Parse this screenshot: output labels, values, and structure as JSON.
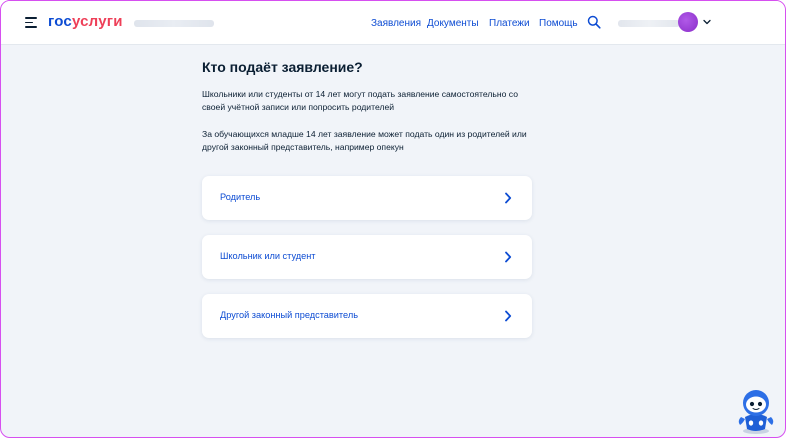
{
  "header": {
    "logo": {
      "part1": "гос",
      "part2": "услуги"
    },
    "nav": [
      "Заявления",
      "Документы",
      "Платежи",
      "Помощь"
    ],
    "icons": {
      "menu": "burger-menu-icon",
      "search": "search-icon",
      "dropdown": "chevron-down-icon"
    }
  },
  "main": {
    "title": "Кто подаёт заявление?",
    "paragraph1": "Школьники или студенты от 14 лет могут подать заявление самостоятельно со своей учётной записи или попросить родителей",
    "paragraph2": "За обучающихся младше 14 лет заявление может подать один из родителей или другой законный представитель, например опекун",
    "options": [
      {
        "label": "Родитель"
      },
      {
        "label": "Школьник или студент"
      },
      {
        "label": "Другой законный представитель"
      }
    ]
  },
  "colors": {
    "brand_blue": "#0d4cd3",
    "brand_red": "#ee3f58",
    "background": "#f1f4f9",
    "frame_border": "#d64ff0"
  }
}
